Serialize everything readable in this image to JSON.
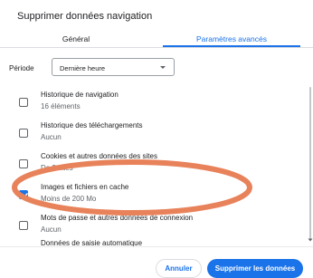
{
  "dialog": {
    "title": "Supprimer données navigation"
  },
  "tabs": [
    {
      "label": "Général",
      "active": false
    },
    {
      "label": "Paramètres avancés",
      "active": true
    }
  ],
  "period": {
    "label": "Période",
    "selected": "Dernière heure"
  },
  "items": [
    {
      "title": "Historique de navigation",
      "subtitle": "16 éléments",
      "checked": false
    },
    {
      "title": "Historique des téléchargements",
      "subtitle": "Aucun",
      "checked": false
    },
    {
      "title": "Cookies et autres données des sites",
      "subtitle": "De 3 sites",
      "checked": false
    },
    {
      "title": "Images et fichiers en cache",
      "subtitle": "Moins de 200 Mo",
      "checked": true
    },
    {
      "title": "Mots de passe et autres données de connexion",
      "subtitle": "Aucun",
      "checked": false
    },
    {
      "title": "Données de saisie automatique",
      "subtitle": "",
      "checked": false
    }
  ],
  "buttons": {
    "cancel": "Annuler",
    "delete": "Supprimer les données"
  },
  "colors": {
    "accent": "#1a73e8",
    "annotation": "#e8825a",
    "text": "#202124",
    "muted": "#5f6368"
  }
}
